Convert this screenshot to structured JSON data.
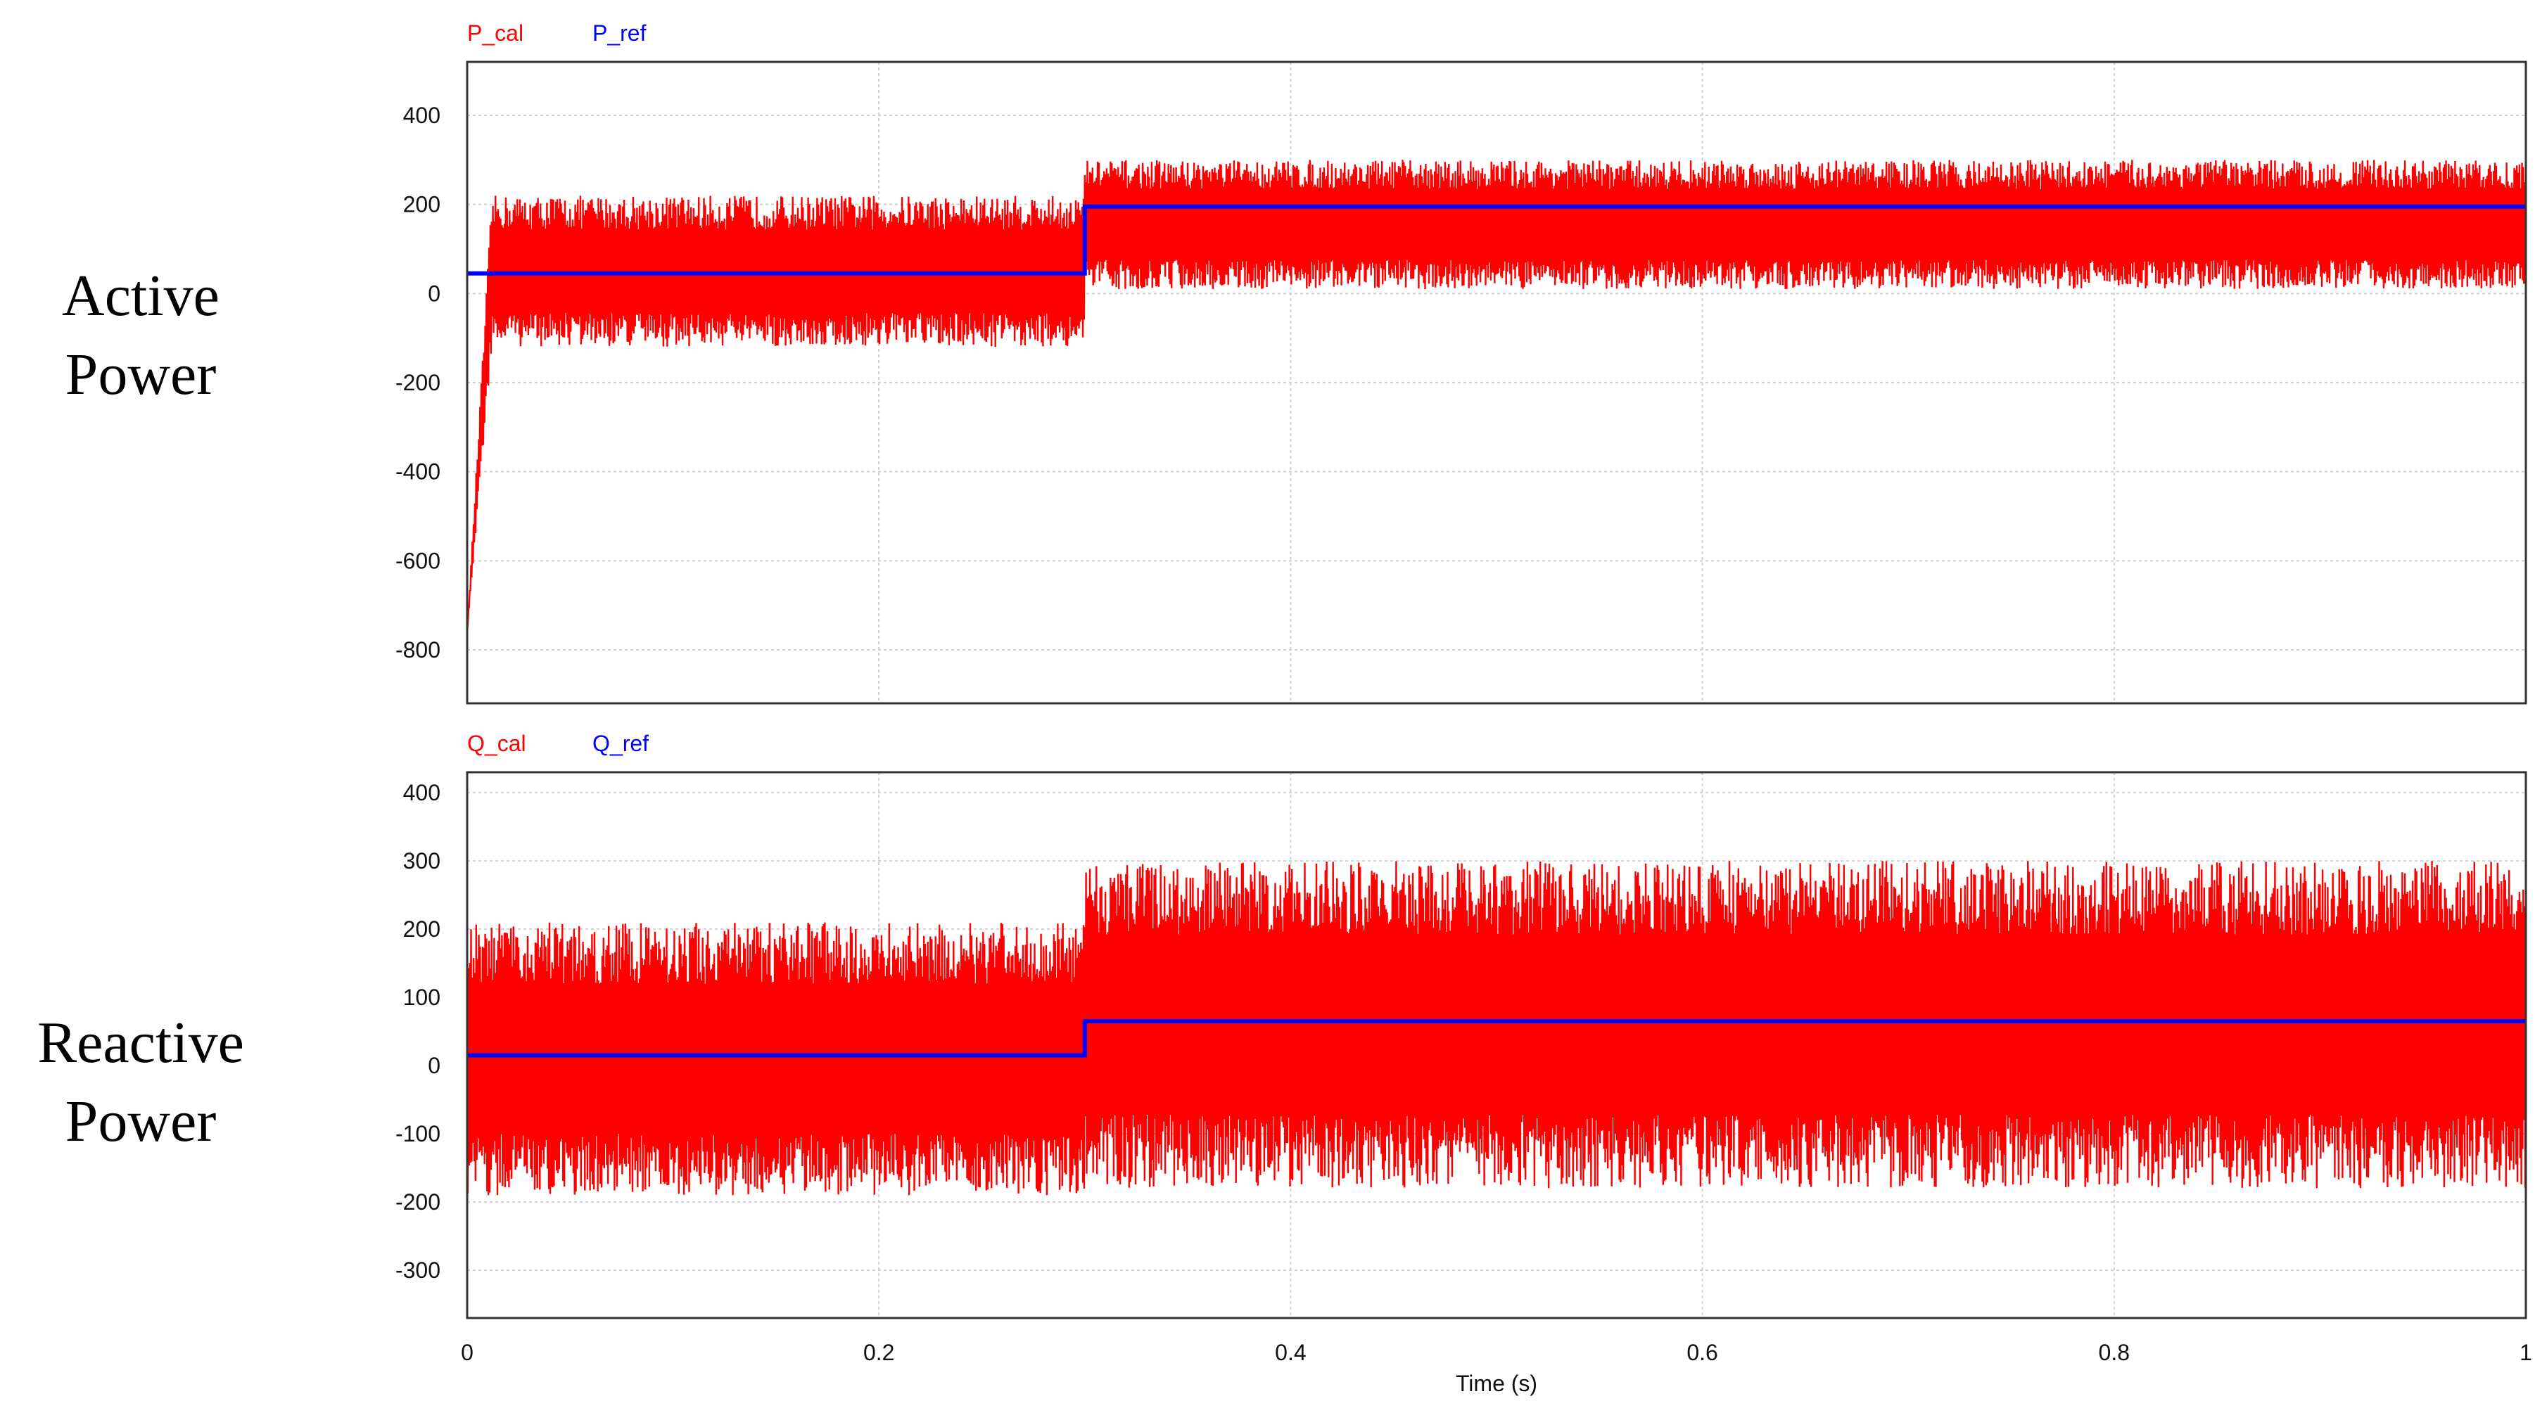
{
  "side_labels": {
    "active": [
      "Active",
      "Power"
    ],
    "reactive": [
      "Reactive",
      "Power"
    ]
  },
  "chart_data": [
    {
      "type": "line",
      "ylim": [
        -920,
        520
      ],
      "xlim": [
        0,
        1
      ],
      "yticks": [
        400,
        200,
        0,
        -200,
        -400,
        -600,
        -800
      ],
      "ytick_labels": [
        "400",
        "200",
        "0",
        "-200",
        "-400",
        "-600",
        "-800"
      ],
      "xticks": [
        0,
        0.2,
        0.4,
        0.6,
        0.8,
        1
      ],
      "grid": true,
      "legend": "top-left",
      "series": [
        {
          "name": "P_cal",
          "color": "#ff0000",
          "style": "noisy-oscillation",
          "segments": [
            {
              "x0": 0.0,
              "x1": 0.3,
              "upper": 220,
              "lower": -120
            },
            {
              "x0": 0.3,
              "x1": 1.0,
              "upper": 300,
              "lower": 10
            }
          ],
          "startup_dip": -760
        },
        {
          "name": "P_ref",
          "color": "#0000ff",
          "style": "step",
          "x": [
            0,
            0.3,
            0.3,
            1
          ],
          "y": [
            45,
            45,
            195,
            195
          ]
        }
      ]
    },
    {
      "type": "line",
      "ylim": [
        -370,
        430
      ],
      "xlim": [
        0,
        1
      ],
      "yticks": [
        400,
        300,
        200,
        100,
        0,
        -100,
        -200,
        -300
      ],
      "ytick_labels": [
        "400",
        "300",
        "200",
        "100",
        "0",
        "-100",
        "-200",
        "-300"
      ],
      "xticks": [
        0,
        0.2,
        0.4,
        0.6,
        0.8,
        1
      ],
      "xtick_labels": [
        "0",
        "0.2",
        "0.4",
        "0.6",
        "0.8",
        "1"
      ],
      "xlabel": "Time (s)",
      "grid": true,
      "legend": "top-left",
      "series": [
        {
          "name": "Q_cal",
          "color": "#ff0000",
          "style": "noisy-oscillation",
          "segments": [
            {
              "x0": 0.0,
              "x1": 0.3,
              "upper": 210,
              "lower": -190
            },
            {
              "x0": 0.3,
              "x1": 1.0,
              "upper": 300,
              "lower": -180
            }
          ]
        },
        {
          "name": "Q_ref",
          "color": "#0000ff",
          "style": "step",
          "x": [
            0,
            0.3,
            0.3,
            1
          ],
          "y": [
            15,
            15,
            65,
            65
          ]
        }
      ]
    }
  ]
}
